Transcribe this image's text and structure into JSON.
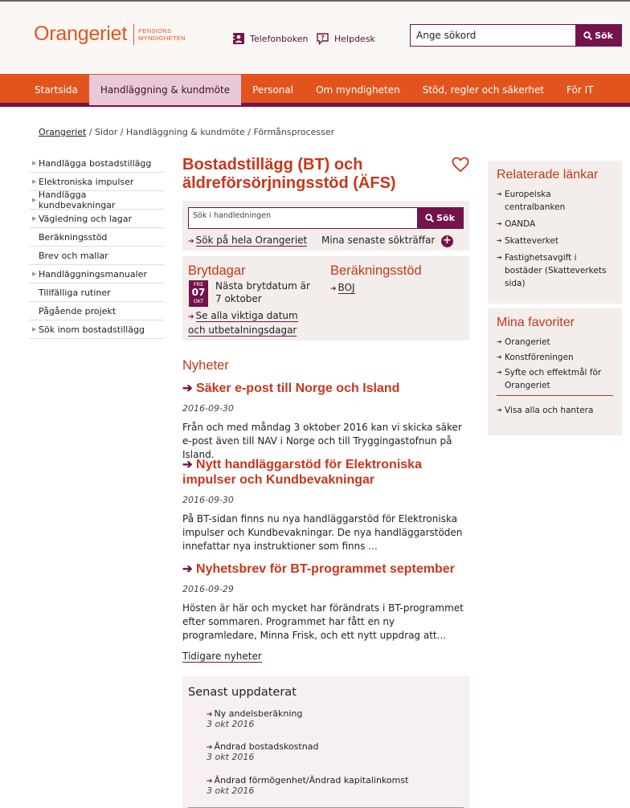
{
  "logo": {
    "name": "Orangeriet",
    "sub_line1": "PENSIONS",
    "sub_line2": "MYNDIGHETEN"
  },
  "toplinks": [
    {
      "label": "Telefonboken",
      "icon": "phonebook-icon"
    },
    {
      "label": "Helpdesk",
      "icon": "helpdesk-icon"
    }
  ],
  "top_search": {
    "placeholder": "Ange sökord",
    "button": "Sök"
  },
  "nav": [
    "Startsida",
    "Handläggning & kundmöte",
    "Personal",
    "Om myndigheten",
    "Stöd, regler och säkerhet",
    "För IT"
  ],
  "breadcrumb": {
    "home": "Orangeriet",
    "rest": " / Sidor / Handläggning & kundmöte / Förmånsprocesser"
  },
  "leftnav": [
    {
      "label": "Handlägga bostadstillägg",
      "caret": true
    },
    {
      "label": "Elektroniska impulser",
      "caret": true
    },
    {
      "label": "Handlägga kundbevakningar",
      "caret": true
    },
    {
      "label": "Vägledning och lagar",
      "caret": true
    },
    {
      "label": "Beräkningsstöd",
      "caret": false
    },
    {
      "label": "Brev och mallar",
      "caret": false
    },
    {
      "label": "Handläggningsmanualer",
      "caret": true
    },
    {
      "label": "Tillfälliga rutiner",
      "caret": false
    },
    {
      "label": "Pågående projekt",
      "caret": false
    },
    {
      "label": "Sök inom bostadstillägg",
      "caret": true
    }
  ],
  "main": {
    "title": "Bostadstillägg (BT) och äldreförsörjningsstöd (ÄFS)",
    "search": {
      "placeholder": "Sök i handledningen",
      "button": "Sök",
      "link": "Sök på hela Orangeriet",
      "recent": "Mina senaste sökträffar"
    },
    "brytdagar": {
      "heading": "Brytdagar",
      "cal_day": "FRE",
      "cal_date": "07",
      "cal_month": "OKT",
      "text": "Nästa brytdatum är 7 oktober",
      "link": "Se alla viktiga datum och utbetalningsdagar"
    },
    "berakning": {
      "heading": "Beräkningsstöd",
      "link": "BOJ"
    },
    "news_heading": "Nyheter",
    "news": [
      {
        "title": "Säker e-post till Norge och Island",
        "date": "2016-09-30",
        "text": "Från och med måndag 3 oktober 2016 kan vi skicka säker e-post även till NAV i Norge och till Tryggingastofnun på Island."
      },
      {
        "title": "Nytt handläggarstöd för Elektroniska impulser och Kundbevakningar",
        "date": "2016-09-30",
        "text": "På BT-sidan finns nu nya handläggarstöd för Elektroniska impulser och Kundbevakningar. De nya handläggarstöden innefattar nya instruktioner som finns ..."
      },
      {
        "title": "Nyhetsbrev för BT-programmet september",
        "date": "2016-09-29",
        "text": "Hösten är här och mycket har förändrats i BT-programmet efter sommaren. Programmet har fått en ny programledare, Minna Frisk, och ett nytt uppdrag att..."
      }
    ],
    "prev_news": "Tidigare nyheter",
    "updated": {
      "heading": "Senast uppdaterat",
      "items": [
        {
          "title": "Ny andelsberäkning",
          "date": "3 okt 2016"
        },
        {
          "title": "Ändrad bostadskostnad",
          "date": "3 okt 2016"
        },
        {
          "title": "Ändrad förmögenhet/Ändrad kapitalinkomst",
          "date": "3 okt 2016"
        }
      ]
    }
  },
  "related": {
    "heading": "Relaterade länkar",
    "items": [
      "Europeiska centralbanken",
      "OANDA",
      "Skatteverket",
      "Fastighetsavgift i bostäder (Skatteverkets sida)"
    ]
  },
  "favorites": {
    "heading": "Mina favoriter",
    "items": [
      "Orangeriet",
      "Konstföreningen",
      "Syfte och effektmål för Orangeriet"
    ],
    "manage": "Visa alla och hantera"
  },
  "colors": {
    "orange": "#e2541e",
    "plum": "#74134a",
    "red_heading": "#c8361b",
    "active_tab": "#e9c9d8"
  }
}
